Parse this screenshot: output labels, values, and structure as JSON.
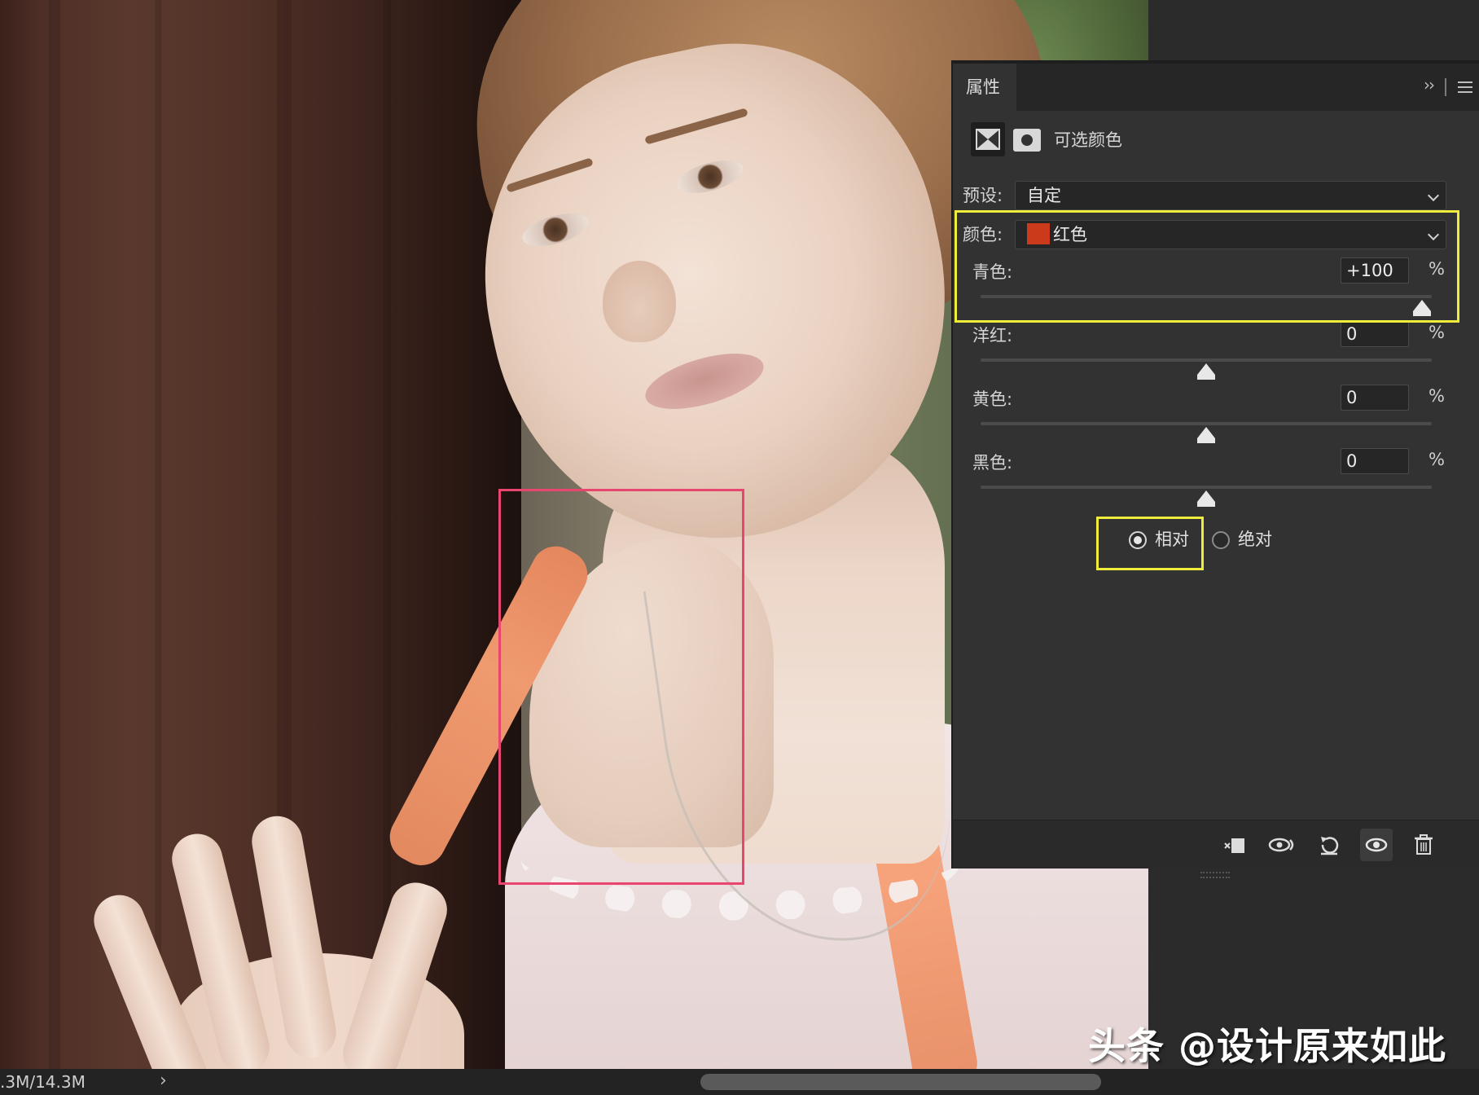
{
  "panel": {
    "tab_label": "属性",
    "collapse_glyph": "››",
    "adjustment_title": "可选颜色",
    "preset_label": "预设:",
    "preset_value": "自定",
    "color_label": "颜色:",
    "color_value": "红色",
    "color_swatch": "#cc3a1c",
    "sliders": [
      {
        "label": "青色:",
        "value": "+100",
        "unit": "%",
        "level": 1.0
      },
      {
        "label": "洋红:",
        "value": "0",
        "unit": "%",
        "level": 0.5
      },
      {
        "label": "黄色:",
        "value": "0",
        "unit": "%",
        "level": 0.5
      },
      {
        "label": "黑色:",
        "value": "0",
        "unit": "%",
        "level": 0.5
      }
    ],
    "method": {
      "relative_label": "相对",
      "absolute_label": "绝对",
      "selected": "relative"
    },
    "bottom_icons": [
      "clip-to-layer-icon",
      "view-previous-state-icon",
      "reset-icon",
      "visibility-eye-icon",
      "trash-icon"
    ]
  },
  "status": {
    "doc_size": ".3M/14.3M",
    "arrow": "›"
  },
  "watermark": "头条 @设计原来如此",
  "colors": {
    "highlight": "#f0ec3c",
    "selection_box": "#e8466e",
    "panel_bg": "#323232"
  }
}
